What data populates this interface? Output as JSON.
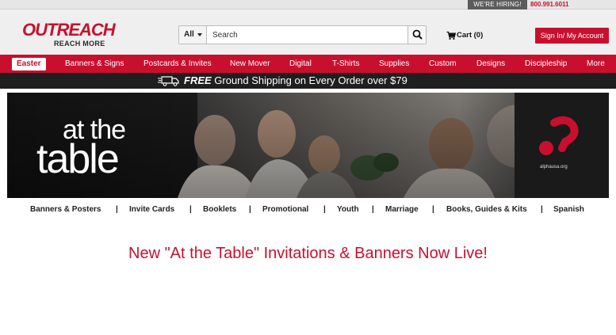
{
  "topbar": {
    "hiring": "WE'RE HIRING!",
    "phone": "800.991.6011"
  },
  "logo": {
    "main": "OUTREACH",
    "tagline": "REACH MORE",
    "brand_color": "#c8102e"
  },
  "search": {
    "category": "All",
    "placeholder": "Search",
    "value": "",
    "button_icon": "search-icon"
  },
  "cart": {
    "label": "Cart (0)",
    "icon": "cart-icon"
  },
  "account": {
    "signin_label": "Sign In/ My Account"
  },
  "nav": {
    "items": [
      {
        "label": "Easter",
        "active": true
      },
      {
        "label": "Banners & Signs"
      },
      {
        "label": "Postcards & Invites"
      },
      {
        "label": "New Mover"
      },
      {
        "label": "Digital"
      },
      {
        "label": "T-Shirts"
      },
      {
        "label": "Supplies"
      },
      {
        "label": "Custom"
      },
      {
        "label": "Designs"
      },
      {
        "label": "Discipleship"
      },
      {
        "label": "More"
      }
    ]
  },
  "shipping": {
    "free": "FREE",
    "text": " Ground Shipping on Every Order over $79",
    "icon": "truck-icon"
  },
  "banner": {
    "title_top": "at the",
    "title_bottom": "table",
    "partner_url": "alphausa.org"
  },
  "categories": [
    "Banners & Posters",
    "Invite Cards",
    "Booklets",
    "Promotional",
    "Youth",
    "Marriage",
    "Books, Guides & Kits",
    "Spanish"
  ],
  "category_separator": "|",
  "headline": "New \"At the Table\" Invitations & Banners Now Live!"
}
